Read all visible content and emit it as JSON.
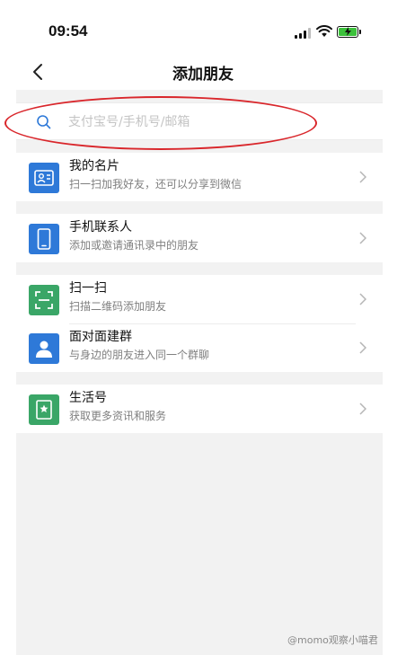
{
  "status_bar": {
    "time": "09:54"
  },
  "nav": {
    "title": "添加朋友"
  },
  "search": {
    "placeholder": "支付宝号/手机号/邮箱",
    "value": ""
  },
  "groups": [
    {
      "items": [
        {
          "title": "我的名片",
          "subtitle": "扫一扫加我好友，还可以分享到微信",
          "icon": "business-card-icon",
          "color": "#2e79d8"
        }
      ]
    },
    {
      "items": [
        {
          "title": "手机联系人",
          "subtitle": "添加或邀请通讯录中的朋友",
          "icon": "phone-icon",
          "color": "#2e79d8"
        }
      ]
    },
    {
      "items": [
        {
          "title": "扫一扫",
          "subtitle": "扫描二维码添加朋友",
          "icon": "scan-icon",
          "color": "#3aa667"
        },
        {
          "title": "面对面建群",
          "subtitle": "与身边的朋友进入同一个群聊",
          "icon": "person-icon",
          "color": "#2e79d8"
        }
      ]
    },
    {
      "items": [
        {
          "title": "生活号",
          "subtitle": "获取更多资讯和服务",
          "icon": "bookmark-star-icon",
          "color": "#3aa667"
        }
      ]
    }
  ],
  "watermark": "@momo观察小喵君",
  "colors": {
    "highlight": "#d9262b",
    "blue": "#2e79d8",
    "green": "#3aa667"
  }
}
